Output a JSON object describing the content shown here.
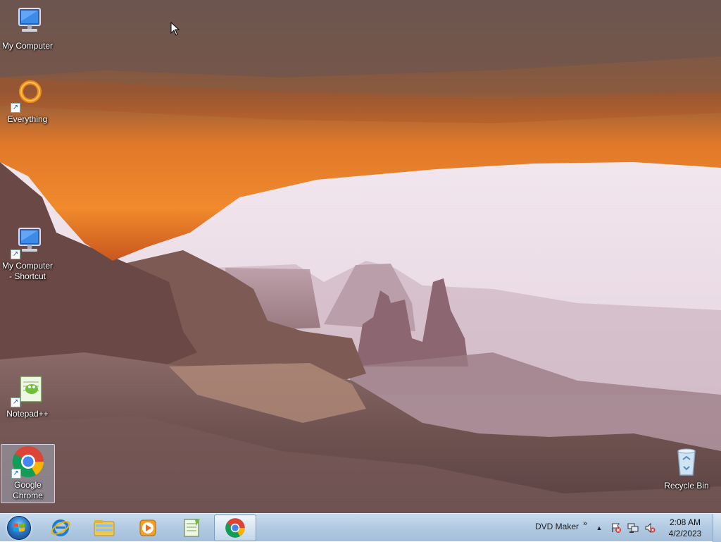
{
  "desktop": {
    "icons": [
      {
        "label": "My Computer",
        "icon": "computer-icon"
      },
      {
        "label": "Everything",
        "icon": "everything-search-icon"
      },
      {
        "label": "My Computer - Shortcut",
        "icon": "computer-icon"
      },
      {
        "label": "Notepad++",
        "icon": "notepad-plus-plus-icon"
      },
      {
        "label": "Google Chrome",
        "icon": "chrome-icon"
      },
      {
        "label": "Recycle Bin",
        "icon": "recycle-bin-icon"
      }
    ],
    "wallpaper": "mesa-arch-canyon"
  },
  "taskbar": {
    "start_icon": "windows-start-orb",
    "pinned": [
      {
        "name": "Internet Explorer",
        "icon": "internet-explorer-icon"
      },
      {
        "name": "Windows Explorer",
        "icon": "file-explorer-icon"
      },
      {
        "name": "Media Player",
        "icon": "media-player-icon"
      },
      {
        "name": "Notepad++",
        "icon": "notepad-plus-plus-icon"
      },
      {
        "name": "Google Chrome",
        "icon": "chrome-icon",
        "active": true
      }
    ],
    "toolbar_label": "DVD Maker",
    "toolbar_chevron": "»",
    "tray": {
      "show_hidden": "▲",
      "icons": [
        "action-center-icon",
        "network-icon",
        "volume-muted-icon"
      ]
    },
    "clock": {
      "time": "2:08 AM",
      "date": "4/2/2023"
    }
  },
  "colors": {
    "taskbar": "#b3cbe3",
    "sky": "#f6e9f2",
    "rock": "#e27a2a"
  }
}
